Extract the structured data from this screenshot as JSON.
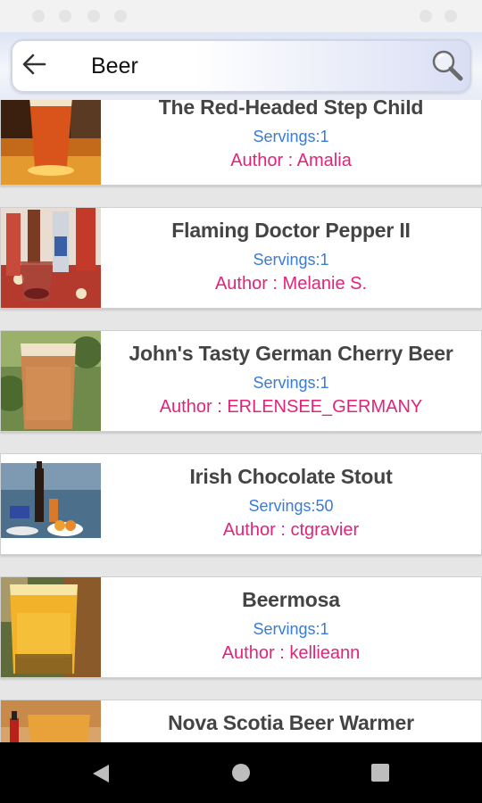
{
  "search": {
    "query": "Beer",
    "back_icon": "back-arrow-icon",
    "search_icon": "magnifier-icon"
  },
  "recipes": [
    {
      "title": "The Red-Headed Step Child",
      "servings": "Servings:1",
      "author": "Author : Amalia"
    },
    {
      "title": "Flaming Doctor Pepper II",
      "servings": "Servings:1",
      "author": "Author : Melanie S."
    },
    {
      "title": "John's Tasty German Cherry Beer",
      "servings": "Servings:1",
      "author": "Author : ERLENSEE_GERMANY"
    },
    {
      "title": "Irish Chocolate Stout",
      "servings": "Servings:50",
      "author": "Author : ctgravier"
    },
    {
      "title": "Beermosa",
      "servings": "Servings:1",
      "author": "Author : kellieann"
    },
    {
      "title": "Nova Scotia Beer Warmer",
      "servings": "",
      "author": ""
    }
  ],
  "colors": {
    "title": "#444444",
    "servings": "#3a7bd5",
    "author": "#e0247a"
  },
  "nav": {
    "back_icon": "triangle-back-icon",
    "home_icon": "circle-home-icon",
    "recents_icon": "square-recents-icon"
  }
}
